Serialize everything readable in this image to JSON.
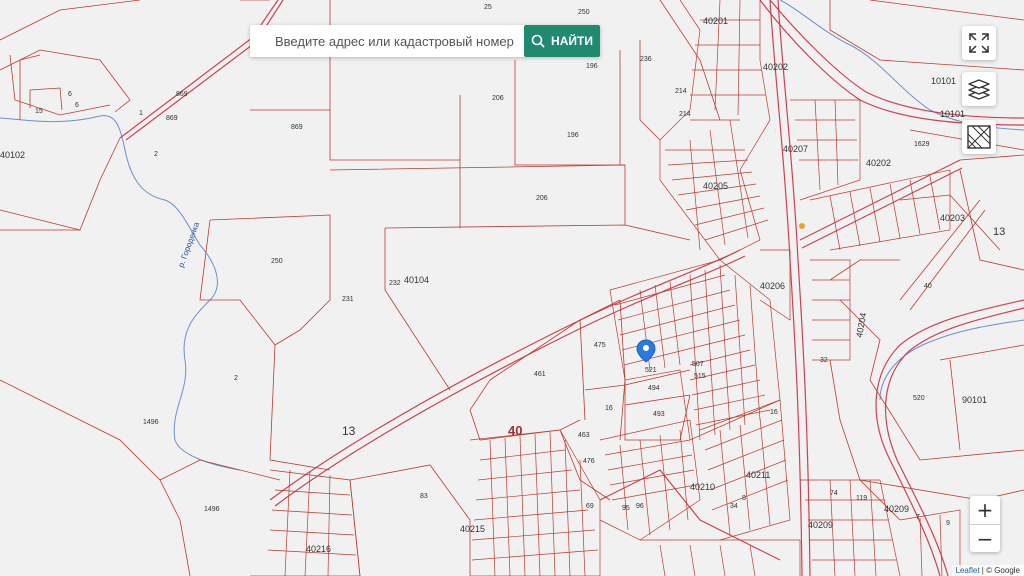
{
  "search": {
    "placeholder": "Введите адрес или кадастровый номер",
    "button_label": "НАЙТИ"
  },
  "controls": {
    "fullscreen_icon": "fullscreen-icon",
    "layers_icon": "layers-icon",
    "cadastre_icon": "cadastre-layer-icon"
  },
  "zoom": {
    "in_label": "+",
    "out_label": "−"
  },
  "attribution": {
    "leaflet": "Leaflet",
    "separator": " | © ",
    "google": "Google"
  },
  "colors": {
    "parcel": "#c0392b",
    "road": "#d04050",
    "water": "#6a8fd0",
    "button": "#1f8a70"
  },
  "map_labels": {
    "l1": "25",
    "l2": "236",
    "l3": "40201",
    "l4": "250",
    "l5": "196",
    "l6": "869",
    "l7": "869",
    "l8": "869",
    "l9": "15",
    "l10": "6",
    "l11": "6",
    "l12": "40102",
    "l13": "2",
    "l14": "206",
    "l15": "196",
    "l16": "214",
    "l17": "214",
    "l18": "40202",
    "l19": "10101",
    "l20": "10101",
    "l21": "40207",
    "l22": "40202",
    "l23": "1629",
    "l24": "40205",
    "l25": "206",
    "l26": "40203",
    "l27": "13",
    "l28": "250",
    "l29": "232",
    "l30": "40104",
    "l31": "231",
    "l32": "40206",
    "l33": "40204",
    "l34": "475",
    "l35": "521",
    "l36": "507",
    "l37": "515",
    "l38": "494",
    "l39": "493",
    "l40": "461",
    "l41": "2",
    "l42": "16",
    "l43": "13",
    "l44": "40",
    "l45": "463",
    "l46": "476",
    "l47": "520",
    "l48": "90101",
    "l49": "1496",
    "l50": "1496",
    "l51": "83",
    "l52": "69",
    "l53": "40210",
    "l54": "40211",
    "l55": "40209",
    "l56": "40209",
    "l57": "40215",
    "l58": "40216",
    "l59": "9",
    "l60": "7",
    "l61": "119",
    "l62": "74",
    "l63": "8",
    "l64": "40",
    "l65": "16",
    "l66": "32",
    "l67": "34",
    "l68": "96",
    "l69": "95",
    "l70": "р. Городенка",
    "l71": "1"
  }
}
